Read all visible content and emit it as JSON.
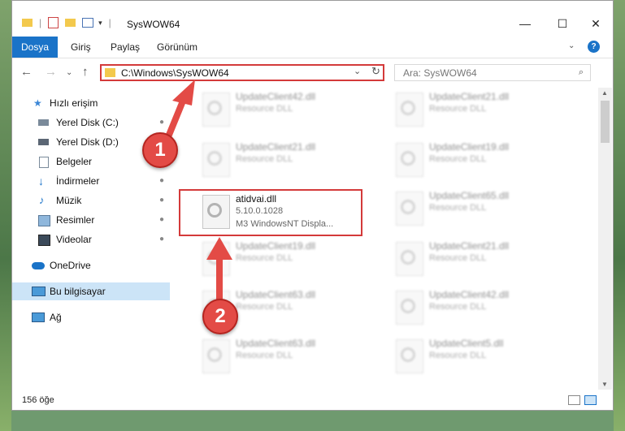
{
  "window": {
    "title": "SysWOW64",
    "minimize": "—",
    "maximize": "☐",
    "close": "✕"
  },
  "ribbon": {
    "tabs": [
      "Dosya",
      "Giriş",
      "Paylaş",
      "Görünüm"
    ],
    "help": "?"
  },
  "navigation": {
    "back": "←",
    "forward": "→",
    "up": "↑",
    "expand": "⌄"
  },
  "address": {
    "path": "C:\\Windows\\SysWOW64",
    "refresh": "↻"
  },
  "search": {
    "placeholder": "Ara: SysWOW64"
  },
  "sidebar": {
    "items": [
      {
        "label": "Hızlı erişim",
        "icon": "star-icon"
      },
      {
        "label": "Yerel Disk (C:)",
        "icon": "drive-icon",
        "pinned": true
      },
      {
        "label": "Yerel Disk (D:)",
        "icon": "drive-icon"
      },
      {
        "label": "Belgeler",
        "icon": "document-icon",
        "pinned": true
      },
      {
        "label": "İndirmeler",
        "icon": "download-icon",
        "pinned": true
      },
      {
        "label": "Müzik",
        "icon": "music-icon",
        "pinned": true
      },
      {
        "label": "Resimler",
        "icon": "picture-icon",
        "pinned": true
      },
      {
        "label": "Videolar",
        "icon": "video-icon",
        "pinned": true
      },
      {
        "label": "OneDrive",
        "icon": "cloud-icon"
      },
      {
        "label": "Bu bilgisayar",
        "icon": "computer-icon",
        "selected": true
      },
      {
        "label": "Ağ",
        "icon": "network-icon"
      }
    ],
    "pin_glyph": "📌"
  },
  "files": {
    "highlighted": {
      "name": "atidvai.dll",
      "version": "5.10.0.1028",
      "description": "M3 WindowsNT Displa..."
    },
    "tiles": [
      {
        "name": "UpdateClient42.dll",
        "type": "Resource DLL"
      },
      {
        "name": "UpdateClient21.dll",
        "type": "Resource DLL"
      },
      {
        "name": "UpdateClient21.dll",
        "type": "Resource DLL"
      },
      {
        "name": "UpdateClient19.dll",
        "type": "Resource DLL"
      },
      {
        "name": "UpdateClient65.dll",
        "type": "Resource DLL"
      },
      {
        "name": "UpdateClient19.dll",
        "type": "Resource DLL"
      },
      {
        "name": "UpdateClient21.dll",
        "type": "Resource DLL"
      },
      {
        "name": "UpdateClient63.dll",
        "type": "Resource DLL"
      },
      {
        "name": "UpdateClient42.dll",
        "type": "Resource DLL"
      },
      {
        "name": "UpdateClient63.dll",
        "type": "Resource DLL"
      },
      {
        "name": "UpdateClient5.dll",
        "type": "Resource DLL"
      }
    ]
  },
  "status": {
    "count": "156 öğe"
  },
  "annotations": {
    "step1": "1",
    "step2": "2",
    "color": "#e34b46"
  }
}
